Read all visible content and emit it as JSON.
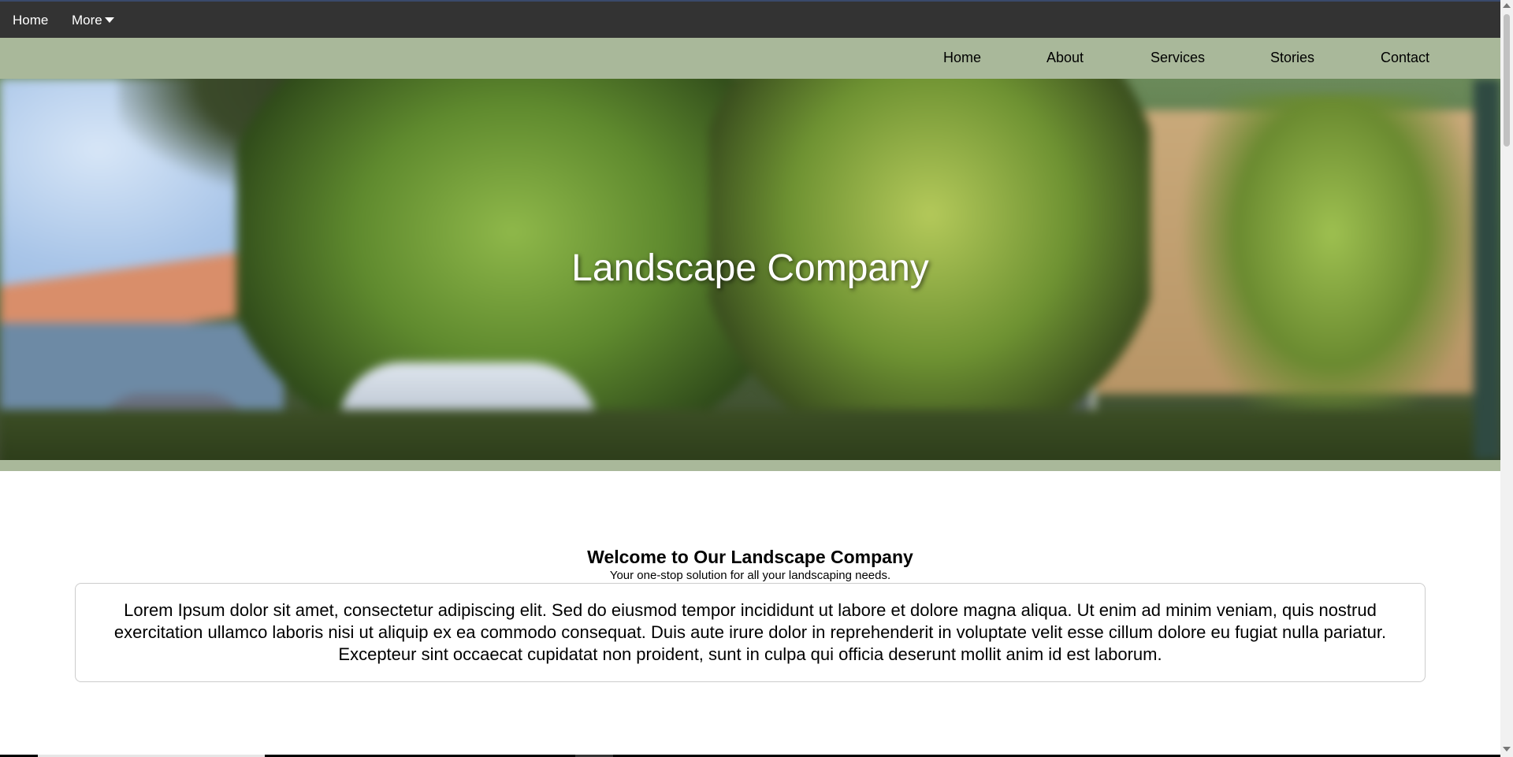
{
  "topbar": {
    "home_label": "Home",
    "more_label": "More"
  },
  "nav": {
    "items": [
      {
        "label": "Home"
      },
      {
        "label": "About"
      },
      {
        "label": "Services"
      },
      {
        "label": "Stories"
      },
      {
        "label": "Contact"
      }
    ]
  },
  "hero": {
    "title": "Landscape Company"
  },
  "welcome": {
    "title": "Welcome to Our Landscape Company",
    "subtitle": "Your one-stop solution for all your landscaping needs.",
    "body": "Lorem Ipsum dolor sit amet, consectetur adipiscing elit. Sed do eiusmod tempor incididunt ut labore et dolore magna aliqua. Ut enim ad minim veniam, quis nostrud exercitation ullamco laboris nisi ut aliquip ex ea commodo consequat. Duis aute irure dolor in reprehenderit in voluptate velit esse cillum dolore eu fugiat nulla pariatur. Excepteur sint occaecat cupidatat non proident, sunt in culpa qui officia deserunt mollit anim id est laborum."
  },
  "colors": {
    "topbar": "#333333",
    "nav_green": "#a9b89a",
    "text_white": "#ffffff"
  }
}
